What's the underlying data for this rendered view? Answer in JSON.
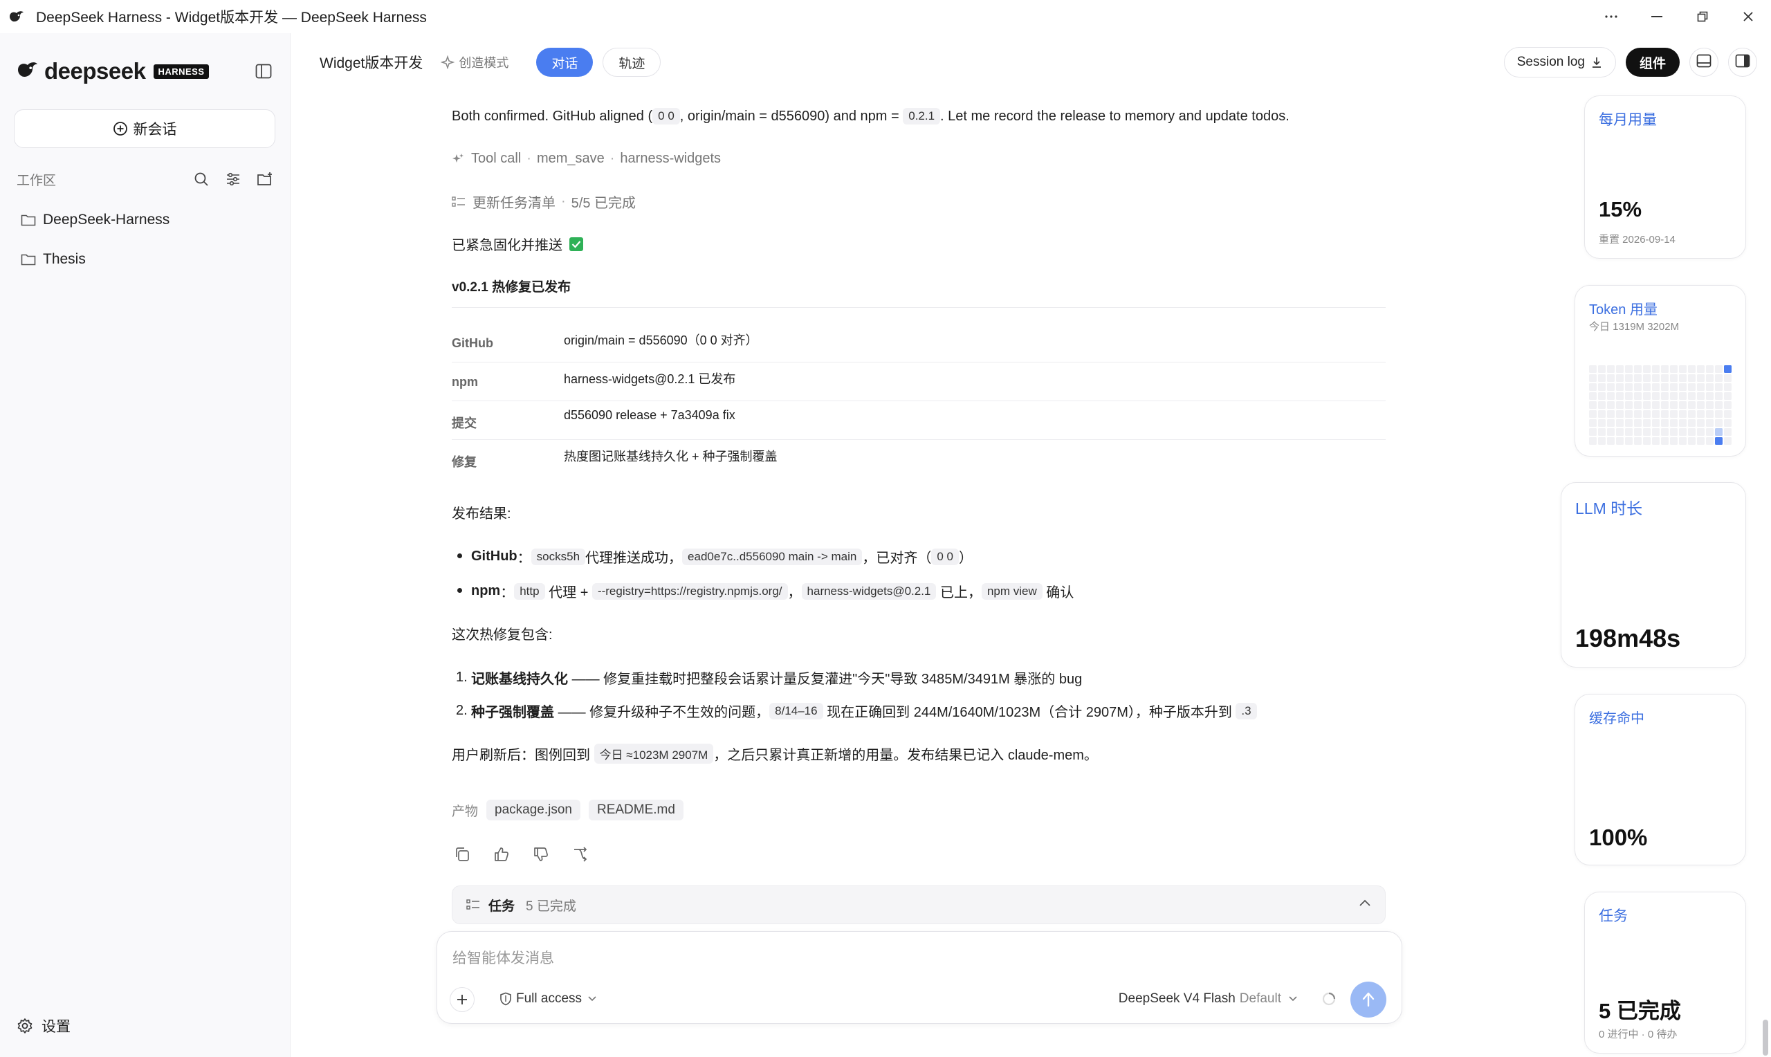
{
  "window": {
    "title": "DeepSeek Harness - Widget版本开发 — DeepSeek Harness"
  },
  "sidebar": {
    "brand": "deepseek",
    "brand_badge": "HARNESS",
    "new_chat_label": "新会话",
    "workspace_label": "工作区",
    "folders": [
      {
        "name": "DeepSeek-Harness"
      },
      {
        "name": "Thesis"
      }
    ],
    "settings_label": "设置"
  },
  "topbar": {
    "conversation_title": "Widget版本开发",
    "mode_label": "创造模式",
    "tabs": [
      {
        "label": "对话",
        "active": true
      },
      {
        "label": "轨迹",
        "active": false
      }
    ],
    "session_log_label": "Session log",
    "components_label": "组件"
  },
  "message": {
    "intro_text_1": "Both confirmed. GitHub aligned (",
    "intro_code_1": "0 0",
    "intro_text_2": ", origin/main = d556090) and npm =",
    "intro_code_2": "0.2.1",
    "intro_text_3": ". Let me record the release to memory and update todos.",
    "tool_call": {
      "label": "Tool call",
      "name": "mem_save",
      "target": "harness-widgets"
    },
    "todo_update": {
      "label": "更新任务清单",
      "status": "5/5 已完成"
    },
    "pushed_text": "已紧急固化并推送",
    "release_heading": "v0.2.1 热修复已发布",
    "release_table": [
      {
        "key": "GitHub",
        "value": "origin/main = d556090（0 0 对齐）"
      },
      {
        "key": "npm",
        "value": "harness-widgets@0.2.1 已发布"
      },
      {
        "key": "提交",
        "value": "d556090 release + 7a3409a fix"
      },
      {
        "key": "修复",
        "value": "热度图记账基线持久化 + 种子强制覆盖"
      }
    ],
    "result_heading": "发布结果:",
    "result_github": {
      "label": "GitHub",
      "code_1": "socks5h",
      "text_1": "代理推送成功，",
      "code_2": "ead0e7c..d556090 main -> main",
      "text_2": "，已对齐（",
      "code_3": "0 0",
      "text_3": "）"
    },
    "result_npm": {
      "label": "npm",
      "code_1": "http",
      "text_1": "代理 +",
      "code_2": "--registry=https://registry.npmjs.org/",
      "text_2": "，",
      "code_3": "harness-widgets@0.2.1",
      "text_3": "已上，",
      "code_4": "npm view",
      "text_4": "确认"
    },
    "hotfix_heading": "这次热修复包含:",
    "hotfix_1": {
      "num": "1.",
      "bold": "记账基线持久化",
      "text": "—— 修复重挂载时把整段会话累计量反复灌进\"今天\"导致 3485M/3491M 暴涨的 bug"
    },
    "hotfix_2": {
      "num": "2.",
      "bold": "种子强制覆盖",
      "text_1": "—— 修复升级种子不生效的问题，",
      "code_1": "8/14–16",
      "text_2": "现在正确回到 244M/1640M/1023M（合计 2907M），种子版本升到",
      "code_2": ".3"
    },
    "after_refresh": {
      "text_1": "用户刷新后：图例回到",
      "code": "今日 ≈1023M 2907M",
      "text_2": "，之后只累计真正新增的用量。发布结果已记入 claude-mem。"
    },
    "artifacts_label": "产物",
    "artifacts": [
      "package.json",
      "README.md"
    ]
  },
  "task_bar": {
    "label": "任务",
    "status": "5 已完成"
  },
  "composer": {
    "placeholder": "给智能体发消息",
    "access_label": "Full access",
    "model_name": "DeepSeek V4 Flash",
    "model_default": "Default"
  },
  "widgets": {
    "monthly_usage": {
      "title": "每月用量",
      "value": "15%",
      "sub": "重置 2026-09-14"
    },
    "token_usage": {
      "title": "Token 用量",
      "sub": "今日 1319M 3202M"
    },
    "llm_duration": {
      "title": "LLM 时长",
      "value": "198m48s"
    },
    "cache_hit": {
      "title": "缓存命中",
      "value": "100%"
    },
    "tasks": {
      "title": "任务",
      "value": "5 已完成",
      "sub": "0 进行中 · 0 待办"
    }
  },
  "colors": {
    "accent": "#4a7df0",
    "widget_title": "#3c6fe0",
    "success": "#2fb157"
  }
}
